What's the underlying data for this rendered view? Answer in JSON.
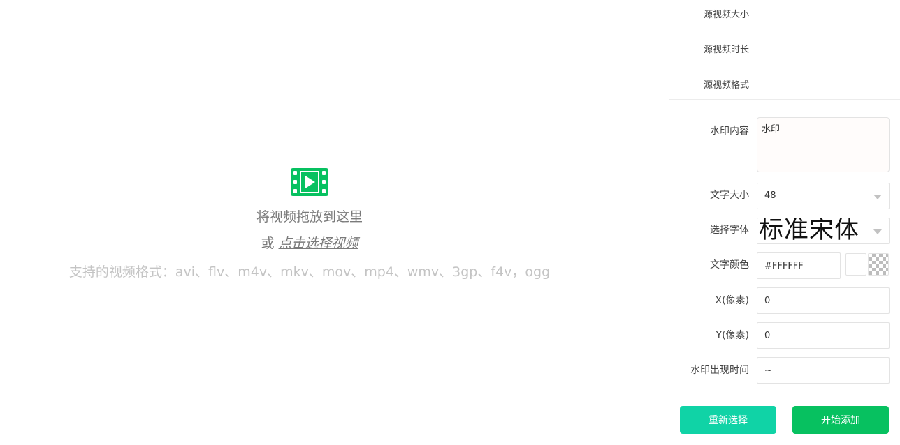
{
  "dropzone": {
    "icon": "video-film-play-icon",
    "title": "将视频拖放到这里",
    "or": "或",
    "select_link": "点击选择视频",
    "formats": "支持的视频格式：avi、flv、m4v、mkv、mov、mp4、wmv、3gp、f4v，ogg"
  },
  "source_info": {
    "size_label": "源视频大小",
    "duration_label": "源视频时长",
    "format_label": "源视频格式"
  },
  "form": {
    "content_label": "水印内容",
    "content_value": "水印",
    "size_label": "文字大小",
    "size_value": "48",
    "font_label": "选择字体",
    "font_value": "标准宋体",
    "color_label": "文字颜色",
    "color_value": "#FFFFFF",
    "x_label": "X(像素)",
    "x_value": "0",
    "y_label": "Y(像素)",
    "y_value": "0",
    "time_label": "水印出现时间",
    "time_value": "~"
  },
  "buttons": {
    "reselect": "重新选择",
    "start": "开始添加"
  },
  "colors": {
    "accent_green": "#07c160",
    "accent_teal": "#10d3a6",
    "swatch_white": "#ffffff"
  }
}
